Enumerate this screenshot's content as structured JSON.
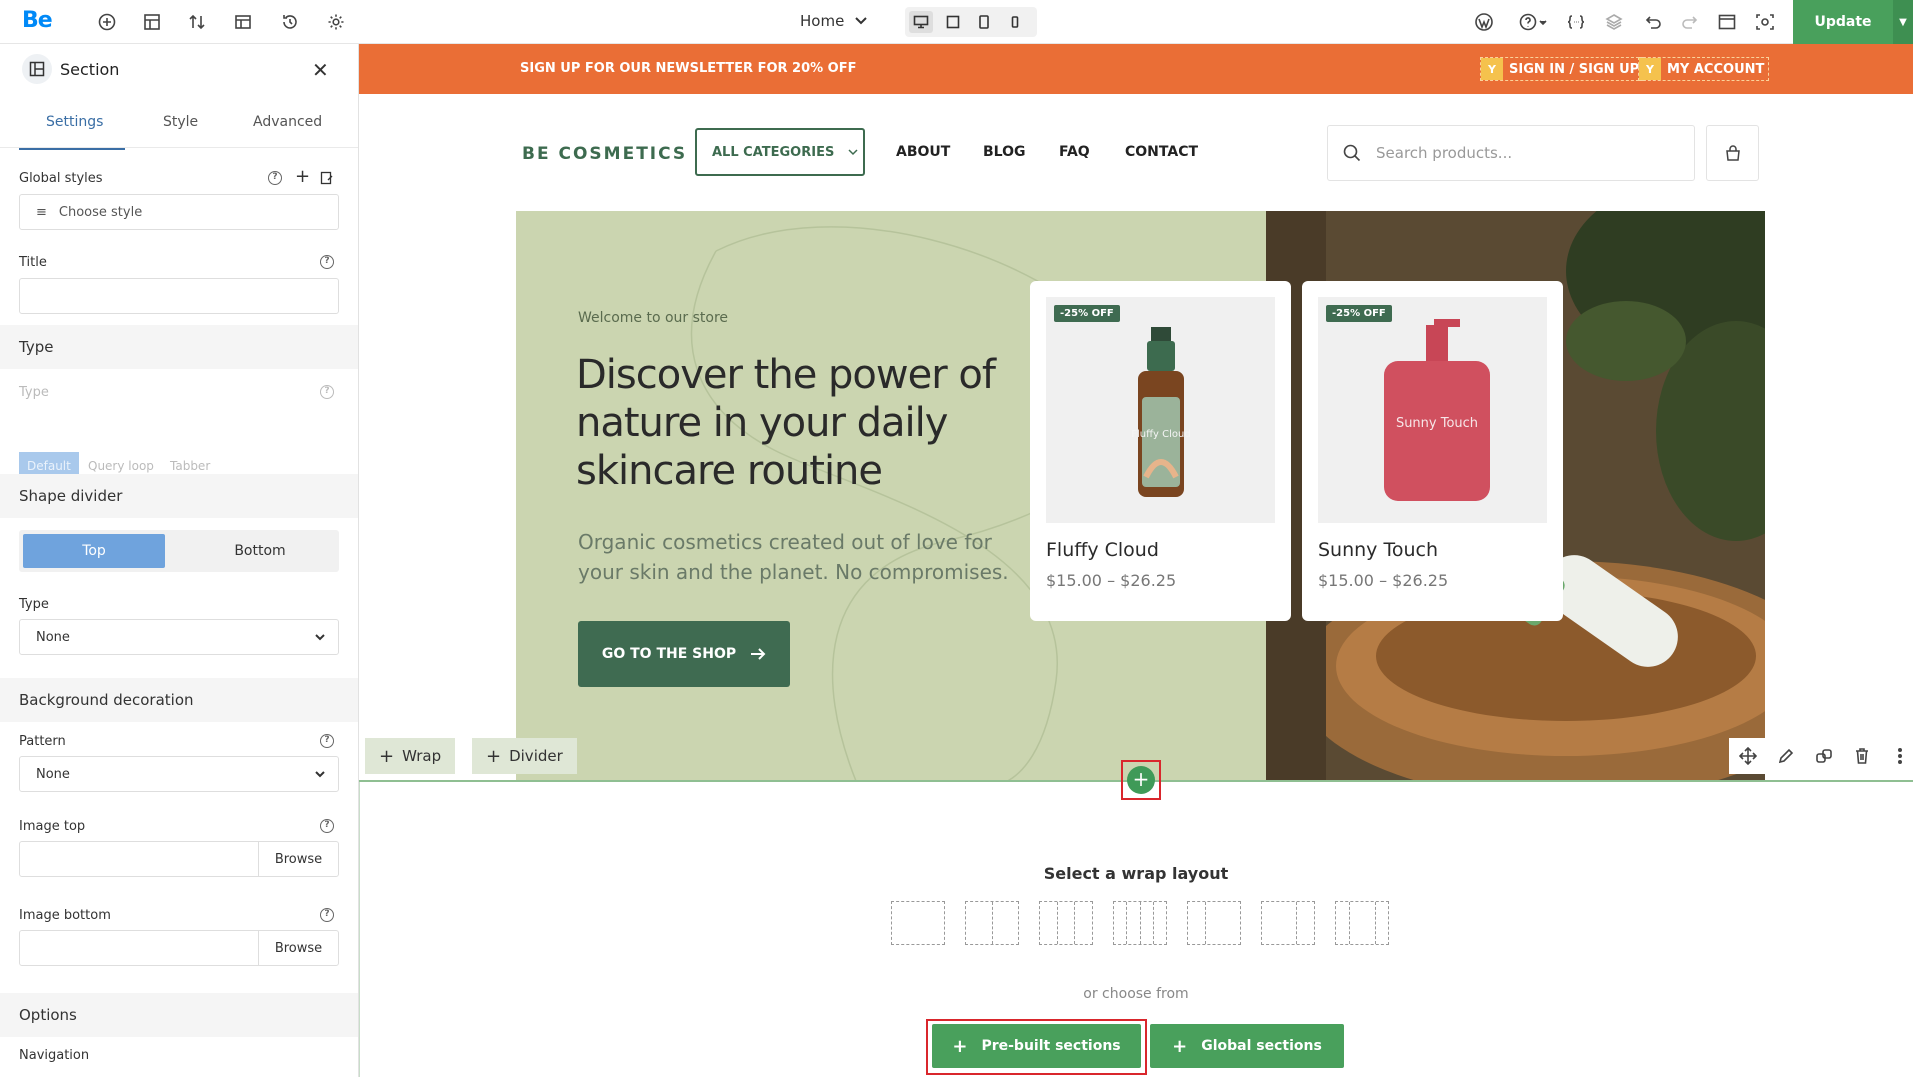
{
  "toolbar": {
    "logo": "Be",
    "page": "Home",
    "update_label": "Update"
  },
  "panel": {
    "title": "Section",
    "tabs": [
      "Settings",
      "Style",
      "Advanced"
    ],
    "global_styles_label": "Global styles",
    "choose_style_placeholder": "Choose style",
    "title_label": "Title",
    "title_value": "",
    "type_group": "Type",
    "type_label": "Type",
    "type_options": [
      "Default",
      "Query loop",
      "Tabber"
    ],
    "shape_divider_group": "Shape divider",
    "shape_divider_options": [
      "Top",
      "Bottom"
    ],
    "shape_type_label": "Type",
    "shape_type_value": "None",
    "bg_decoration_group": "Background decoration",
    "pattern_label": "Pattern",
    "pattern_value": "None",
    "image_top_label": "Image top",
    "image_bottom_label": "Image bottom",
    "browse_label": "Browse",
    "options_group": "Options",
    "navigation_label": "Navigation"
  },
  "site": {
    "promo_text": "SIGN UP FOR OUR NEWSLETTER FOR 20% OFF",
    "sign_in": "SIGN IN / SIGN UP",
    "my_account": "MY ACCOUNT",
    "account_icon_letter": "Y",
    "brand": "BE COSMETICS",
    "all_categories": "ALL CATEGORIES",
    "nav": [
      "ABOUT",
      "BLOG",
      "FAQ",
      "CONTACT"
    ],
    "search_placeholder": "Search products..."
  },
  "hero": {
    "welcome": "Welcome to our store",
    "headline": "Discover the power of nature in your daily skincare routine",
    "subline": "Organic cosmetics created out of love for your skin and the planet. No compromises.",
    "cta": "GO TO THE SHOP",
    "products": [
      {
        "badge": "-25% OFF",
        "name": "Fluffy Cloud",
        "price": "$15.00 – $26.25",
        "label_on_bottle": "Fluffy Cloud"
      },
      {
        "badge": "-25% OFF",
        "name": "Sunny Touch",
        "price": "$15.00 – $26.25",
        "label_on_bottle": "Sunny Touch"
      }
    ]
  },
  "builder": {
    "wrap_label": "Wrap",
    "divider_label": "Divider",
    "wrap_layout_title": "Select a wrap layout",
    "or_choose": "or choose from",
    "prebuilt_label": "Pre-built sections",
    "global_label": "Global sections"
  },
  "colors": {
    "accent_blue": "#0089f7",
    "update_green": "#49a05c",
    "promo_orange": "#ea6e36",
    "brand_green": "#3f6b51",
    "hero_bg": "#cbd5b0",
    "highlight_red": "#d9262c"
  }
}
